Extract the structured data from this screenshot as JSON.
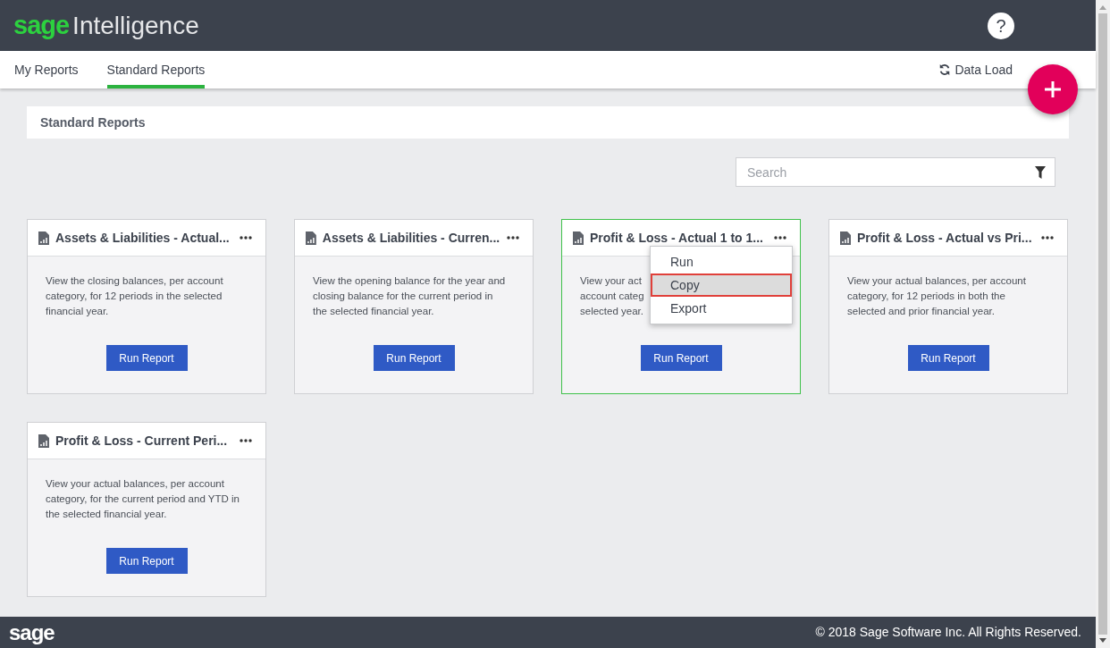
{
  "header": {
    "logo_brand": "sage",
    "logo_product": "Intelligence",
    "help": "?"
  },
  "tabs": [
    {
      "label": "My Reports",
      "selected": false
    },
    {
      "label": "Standard Reports",
      "selected": true
    }
  ],
  "data_load": "Data Load",
  "section_title": "Standard Reports",
  "search": {
    "placeholder": "Search"
  },
  "cards": [
    {
      "title": "Assets & Liabilities - Actual...",
      "description_lines": [
        "View the closing balances, per account",
        "category, for 12 periods in the selected",
        "financial year."
      ],
      "button": "Run Report",
      "selected": false
    },
    {
      "title": "Assets & Liabilities - Curren...",
      "description_lines": [
        "View the opening balance for the year and",
        "closing balance for the current period in",
        "the selected financial year."
      ],
      "button": "Run Report",
      "selected": false
    },
    {
      "title": "Profit & Loss - Actual 1 to 1...",
      "description_lines": [
        "View your act",
        "account categ",
        "selected year."
      ],
      "button": "Run Report",
      "selected": true,
      "menu": [
        {
          "label": "Run",
          "selected": false
        },
        {
          "label": "Copy",
          "selected": true
        },
        {
          "label": "Export",
          "selected": false
        }
      ]
    },
    {
      "title": "Profit & Loss - Actual vs Pri...",
      "description_lines": [
        "View your actual balances, per account",
        "category, for 12 periods in both the",
        "selected and prior financial year."
      ],
      "button": "Run Report",
      "selected": false
    },
    {
      "title": "Profit & Loss - Current Peri...",
      "description_lines": [
        "View your actual balances, per account",
        "category, for the current period and YTD in",
        "the selected financial year."
      ],
      "button": "Run Report",
      "selected": false
    }
  ],
  "footer": {
    "logo": "sage",
    "copyright": "© 2018 Sage Software Inc. All Rights Reserved."
  }
}
